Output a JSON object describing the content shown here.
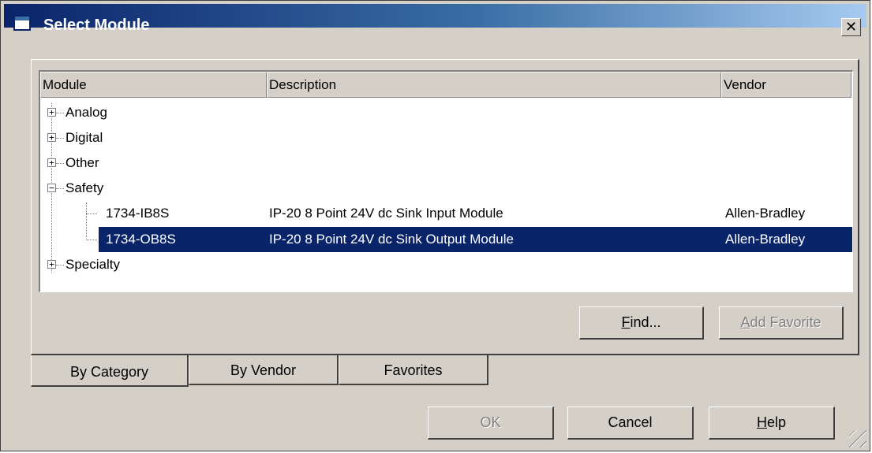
{
  "window": {
    "title": "Select Module",
    "close_glyph": "✕"
  },
  "tree": {
    "columns": [
      "Module",
      "Description",
      "Vendor"
    ],
    "rows": [
      {
        "module": "Analog",
        "description": "",
        "vendor": "",
        "expander": "+",
        "selected": false
      },
      {
        "module": "Digital",
        "description": "",
        "vendor": "",
        "expander": "+",
        "selected": false
      },
      {
        "module": "Other",
        "description": "",
        "vendor": "",
        "expander": "+",
        "selected": false
      },
      {
        "module": "Safety",
        "description": "",
        "vendor": "",
        "expander": "−",
        "selected": false
      },
      {
        "module": "1734-IB8S",
        "description": "IP-20 8 Point 24V dc Sink Input Module",
        "vendor": "Allen-Bradley",
        "expander": "",
        "selected": false
      },
      {
        "module": "1734-OB8S",
        "description": "IP-20 8 Point 24V dc Sink Output Module",
        "vendor": "Allen-Bradley",
        "expander": "",
        "selected": true
      },
      {
        "module": "Specialty",
        "description": "",
        "vendor": "",
        "expander": "+",
        "selected": false
      }
    ]
  },
  "panel_buttons": {
    "find": {
      "label_mnemonic": "F",
      "label_rest": "ind..."
    },
    "add_favorite": {
      "label_mnemonic": "A",
      "label_rest": "dd Favorite"
    }
  },
  "tabs": [
    "By Category",
    "By Vendor",
    "Favorites"
  ],
  "dialog_buttons": {
    "ok": "OK",
    "cancel": "Cancel",
    "help": {
      "label_mnemonic": "H",
      "label_rest": "elp"
    }
  },
  "colors": {
    "selection": "#0a246a",
    "face": "#d4d0c8",
    "title_start": "#0a246a",
    "title_end": "#a6caf0"
  }
}
